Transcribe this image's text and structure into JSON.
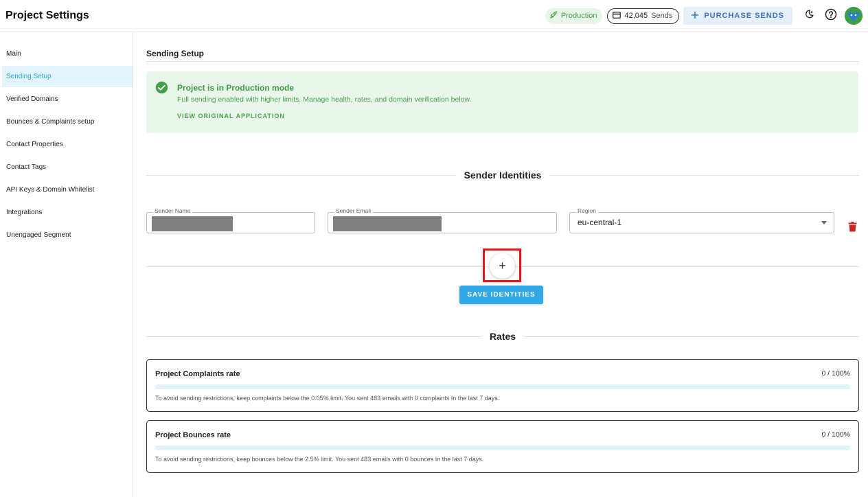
{
  "header": {
    "title": "Project Settings",
    "env_badge": "Production",
    "sends_count": "42,045",
    "sends_unit": "Sends",
    "purchase_label": "PURCHASE SENDS",
    "icons": [
      "rocket-icon",
      "credit-card-icon",
      "plus-icon",
      "dark-mode-icon",
      "help-icon",
      "avatar"
    ]
  },
  "sidebar": {
    "items": [
      {
        "label": "Main",
        "active": false
      },
      {
        "label": "Sending Setup",
        "active": true
      },
      {
        "label": "Verified Domains",
        "active": false
      },
      {
        "label": "Bounces & Complaints setup",
        "active": false
      },
      {
        "label": "Contact Properties",
        "active": false
      },
      {
        "label": "Contact Tags",
        "active": false
      },
      {
        "label": "API Keys & Domain Whitelist",
        "active": false
      },
      {
        "label": "Integrations",
        "active": false
      },
      {
        "label": "Unengaged Segment",
        "active": false
      }
    ]
  },
  "main": {
    "section_title": "Sending Setup",
    "alert": {
      "title": "Project is in Production mode",
      "text": "Full sending enabled with higher limits. Manage health, rates, and domain verification below.",
      "link": "VIEW ORIGINAL APPLICATION"
    },
    "identities": {
      "title": "Sender Identities",
      "name_label": "Sender Name",
      "email_label": "Sender Email",
      "region_label": "Region",
      "region_value": "eu-central-1",
      "add_symbol": "+",
      "save_label": "SAVE IDENTITIES"
    },
    "rates": {
      "title": "Rates",
      "cards": [
        {
          "title": "Project Complaints rate",
          "value": "0 / 100%",
          "progress": 0,
          "note": "To avoid sending restrictions, keep complaints below the 0.05% limit. You sent 483 emails with 0 complaints In the last 7 days."
        },
        {
          "title": "Project Bounces rate",
          "value": "0 / 100%",
          "progress": 0,
          "note": "To avoid sending restrictions, keep bounces below the 2.5% limit. You sent 483 emails with 0 bounces In the last 7 days."
        }
      ]
    }
  },
  "colors": {
    "accent": "#29a6e8",
    "success": "#43a047",
    "danger": "#c62828",
    "highlight": "#e8141b"
  }
}
